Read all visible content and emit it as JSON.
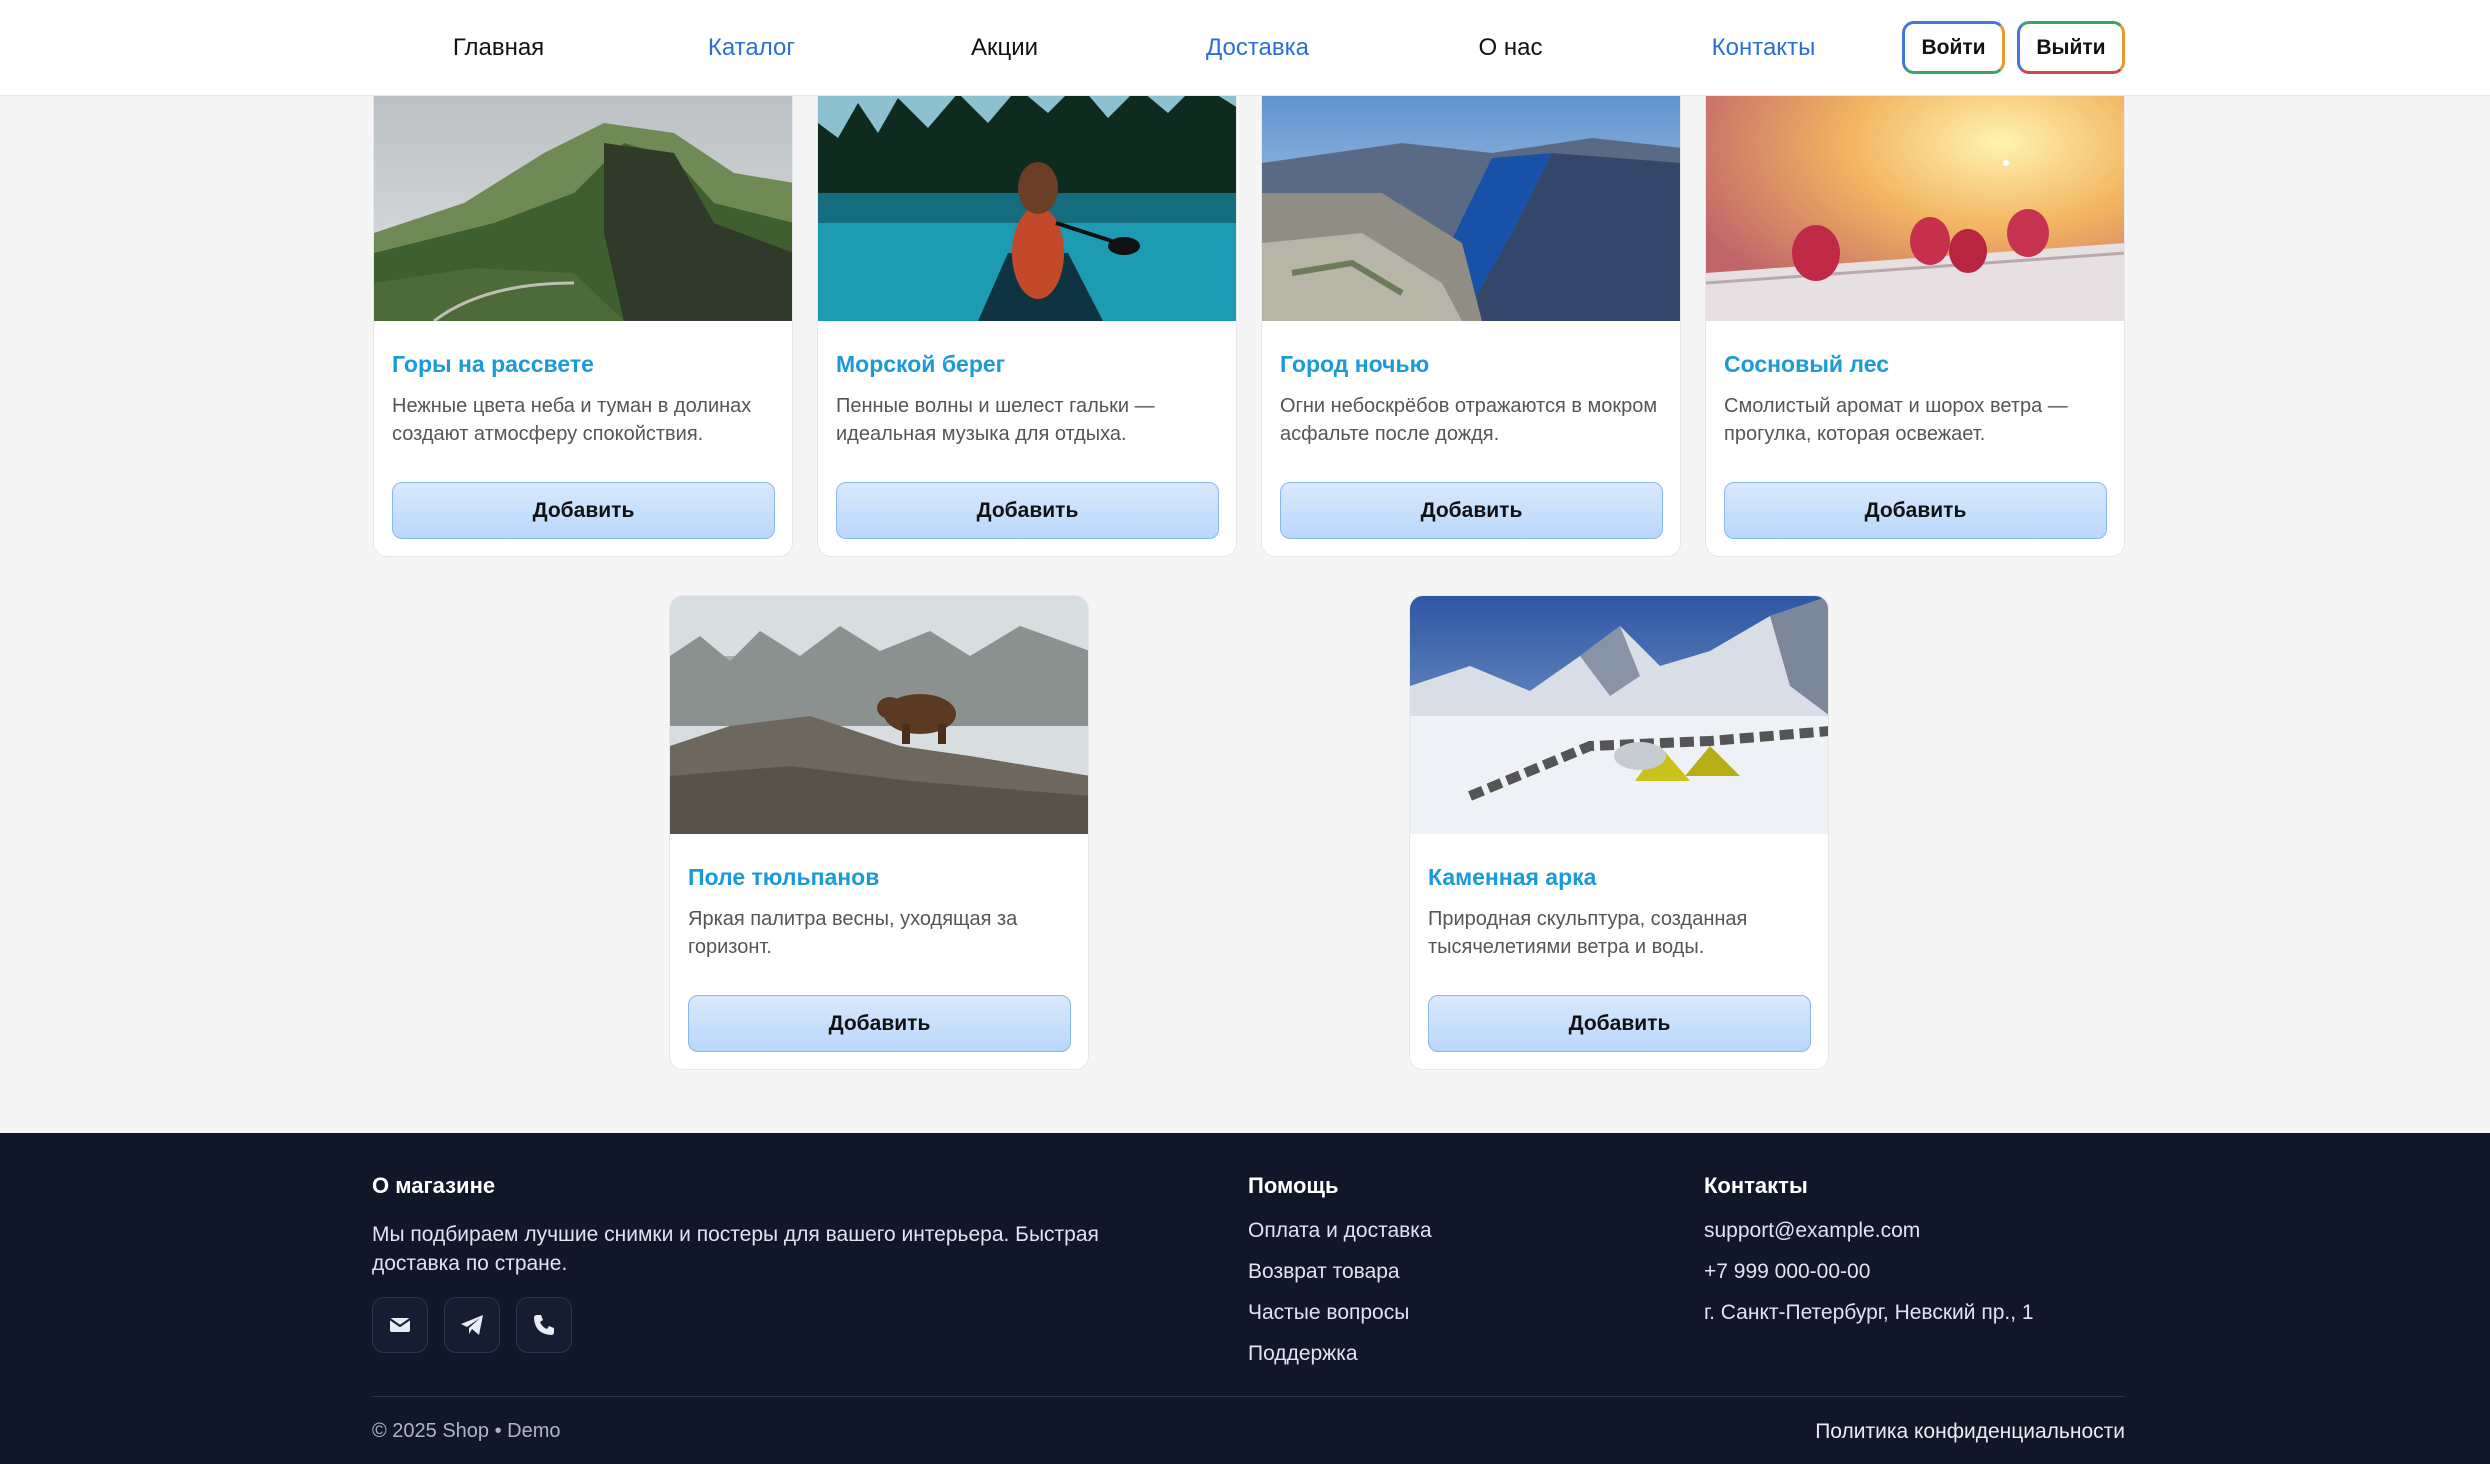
{
  "nav": {
    "items": [
      {
        "label": "Главная"
      },
      {
        "label": "Каталог"
      },
      {
        "label": "Акции"
      },
      {
        "label": "Доставка"
      },
      {
        "label": "О нас"
      },
      {
        "label": "Контакты"
      }
    ],
    "login_label": "Войти",
    "logout_label": "Выйти"
  },
  "products": [
    {
      "title": "Горы на рассвете",
      "description": "Нежные цвета неба и туман в долинах создают атмосферу спокойствия.",
      "button": "Добавить",
      "image": "misty-green-mountains-photo"
    },
    {
      "title": "Морской берег",
      "description": "Пенные волны и шелест гальки — идеальная музыка для отдыха.",
      "button": "Добавить",
      "image": "woman-in-canoe-lake-photo"
    },
    {
      "title": "Город ночью",
      "description": "Огни небоскрёбов отражаются в мокром асфальте после дождя.",
      "button": "Добавить",
      "image": "fjord-cliff-photo"
    },
    {
      "title": "Сосновый лес",
      "description": "Смолистый аромат и шорох ветра — прогулка, которая освежает.",
      "button": "Добавить",
      "image": "raspberries-sunlight-photo"
    },
    {
      "title": "Поле тюльпанов",
      "description": "Яркая палитра весны, уходящая за горизонт.",
      "button": "Добавить",
      "image": "bear-on-rocks-photo"
    },
    {
      "title": "Каменная арка",
      "description": "Природная скульптура, созданная тысячелетиями ветра и воды.",
      "button": "Добавить",
      "image": "snowy-mountain-tents-photo"
    }
  ],
  "footer": {
    "about": {
      "heading": "О магазине",
      "text": "Мы подбираем лучшие снимки и постеры для вашего интерьера. Быстрая доставка по стране."
    },
    "social": [
      "mail-icon",
      "telegram-icon",
      "phone-icon"
    ],
    "help": {
      "heading": "Помощь",
      "links": [
        "Оплата и доставка",
        "Возврат товара",
        "Частые вопросы",
        "Поддержка"
      ]
    },
    "contacts": {
      "heading": "Контакты",
      "email": "support@example.com",
      "phone": "+7 999 000-00-00",
      "address": "г. Санкт-Петербург, Невский пр., 1"
    },
    "copyright": "© 2025 Shop • Demo",
    "policy": "Политика конфиденциальности"
  },
  "colors": {
    "nav_link_blue": "#2b6fd6",
    "card_title": "#1a9ad9",
    "button_bg": "#cfe3fc",
    "footer_bg": "#101729"
  }
}
